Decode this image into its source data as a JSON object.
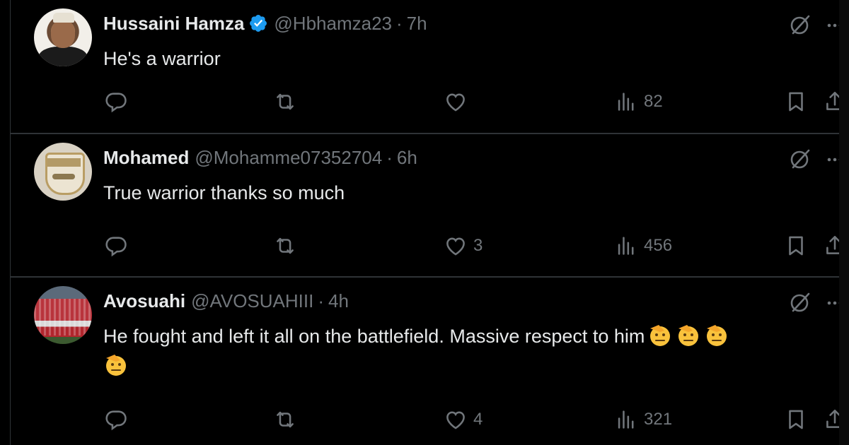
{
  "tweets": [
    {
      "name": "Hussaini Hamza",
      "verified": true,
      "handle": "@Hbhamza23",
      "separator": "·",
      "time": "7h",
      "text": "He's a warrior",
      "replies": "",
      "reposts": "",
      "likes": "",
      "views": "82"
    },
    {
      "name": "Mohamed",
      "verified": false,
      "handle": "@Mohamme07352704",
      "separator": "·",
      "time": "6h",
      "text": "True warrior thanks so much",
      "replies": "",
      "reposts": "",
      "likes": "3",
      "views": "456"
    },
    {
      "name": "Avosuahi",
      "verified": false,
      "handle": "@AVOSUAHIII",
      "separator": "·",
      "time": "4h",
      "text": "He fought and left it all on the battlefield. Massive respect to him",
      "emojis": [
        "saluting-face",
        "saluting-face",
        "saluting-face",
        "saluting-face"
      ],
      "replies": "",
      "reposts": "",
      "likes": "4",
      "views": "321"
    }
  ],
  "icons": {
    "verified": "verified-badge-icon",
    "grok": "grok-icon",
    "more": "more-options-icon",
    "reply": "reply-icon",
    "repost": "repost-icon",
    "like": "heart-icon",
    "views": "views-icon",
    "bookmark": "bookmark-icon",
    "share": "share-icon"
  },
  "colors": {
    "background": "#000000",
    "text": "#e7e9ea",
    "secondary": "#71767b",
    "divider": "#2f3336",
    "verified": "#1d9bf0"
  }
}
